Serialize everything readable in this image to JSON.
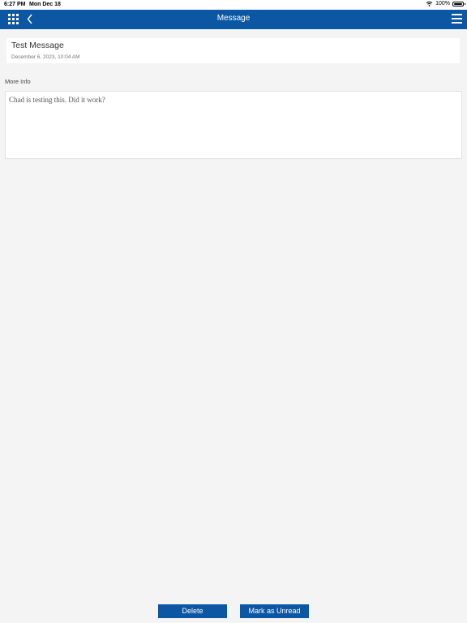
{
  "status_bar": {
    "time": "6:27 PM",
    "date": "Mon Dec 18",
    "battery_text": "100%",
    "wifi_icon": "wifi-icon",
    "battery_level": 1.0
  },
  "nav": {
    "title": "Message",
    "apps_icon": "grid-icon",
    "back_icon": "chevron-left-icon",
    "menu_icon": "hamburger-icon"
  },
  "message": {
    "subject": "Test Message",
    "timestamp": "December 6, 2023, 10:04 AM",
    "more_info_label": "More Info",
    "body": "Chad is testing this. Did it work?"
  },
  "actions": {
    "delete_label": "Delete",
    "mark_unread_label": "Mark as Unread"
  },
  "colors": {
    "nav_background": "#0b57a4",
    "button_background": "#0b57a4",
    "page_background": "#f4f4f4"
  }
}
